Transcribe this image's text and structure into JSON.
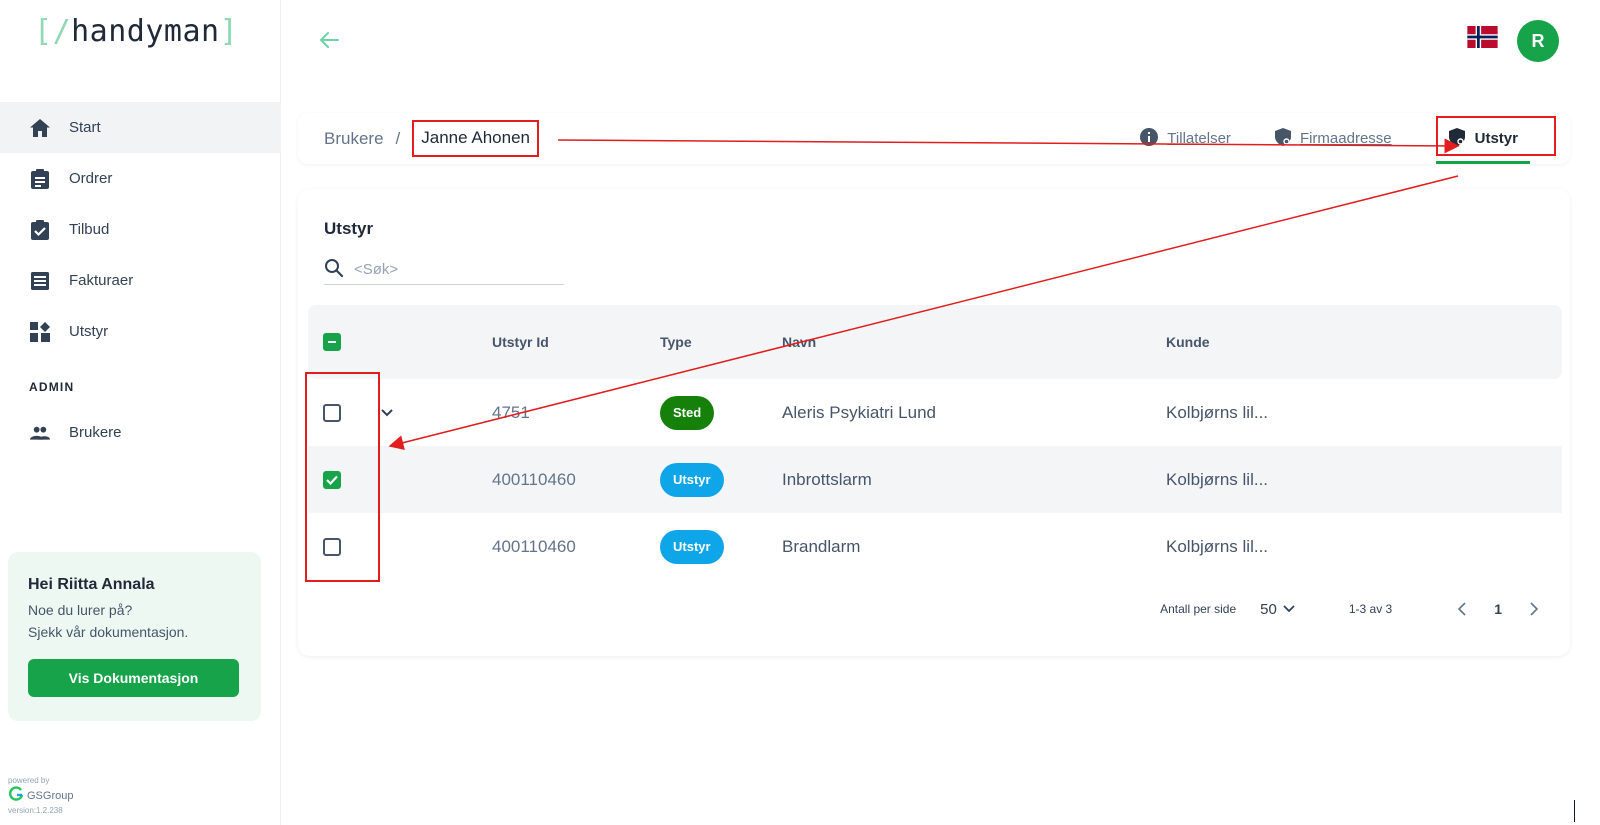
{
  "app": {
    "logo_open": "[",
    "logo_slash": "/",
    "logo_name": "handyman",
    "logo_close": "]"
  },
  "sidebar": {
    "items": [
      {
        "label": "Start",
        "icon": "home-icon"
      },
      {
        "label": "Ordrer",
        "icon": "clipboard-icon"
      },
      {
        "label": "Tilbud",
        "icon": "clipboard-check-icon"
      },
      {
        "label": "Fakturaer",
        "icon": "invoice-icon"
      },
      {
        "label": "Utstyr",
        "icon": "widgets-icon"
      }
    ],
    "section_admin": "ADMIN",
    "admin_items": [
      {
        "label": "Brukere",
        "icon": "people-icon"
      }
    ]
  },
  "help": {
    "title": "Hei Riitta Annala",
    "line1": "Noe du lurer på?",
    "line2": "Sjekk vår dokumentasjon.",
    "button": "Vis Dokumentasjon"
  },
  "footer": {
    "powered_by": "powered by",
    "brand": "GSGroup",
    "version": "version:1.2.238"
  },
  "topbar": {
    "avatar_initial": "R",
    "flag": "norway-flag-icon"
  },
  "breadcrumb": {
    "parent": "Brukere",
    "separator": "/",
    "current": "Janne Ahonen"
  },
  "tabs": [
    {
      "label": "Tillatelser",
      "icon": "info-icon"
    },
    {
      "label": "Firmaadresse",
      "icon": "shield-icon"
    },
    {
      "label": "Utstyr",
      "icon": "shield-settings-icon",
      "active": true
    }
  ],
  "equipment": {
    "title": "Utstyr",
    "search_placeholder": "<Søk>",
    "columns": {
      "id": "Utstyr Id",
      "type": "Type",
      "name": "Navn",
      "customer": "Kunde"
    },
    "rows": [
      {
        "id": "4751",
        "type": "Sted",
        "type_color": "#15800a",
        "name": "Aleris Psykiatri Lund",
        "customer": "Kolbjørns lil...",
        "checked": false,
        "expandable": true
      },
      {
        "id": "400110460",
        "type": "Utstyr",
        "type_color": "#0ea5e9",
        "name": "Inbrottslarm",
        "customer": "Kolbjørns lil...",
        "checked": true,
        "expandable": false
      },
      {
        "id": "400110460",
        "type": "Utstyr",
        "type_color": "#0ea5e9",
        "name": "Brandlarm",
        "customer": "Kolbjørns lil...",
        "checked": false,
        "expandable": false
      }
    ]
  },
  "pagination": {
    "per_page_label": "Antall per side",
    "per_page": "50",
    "range": "1-3 av 3",
    "current_page": "1"
  },
  "colors": {
    "accent": "#16a34a",
    "annotation": "#e11d1d"
  }
}
